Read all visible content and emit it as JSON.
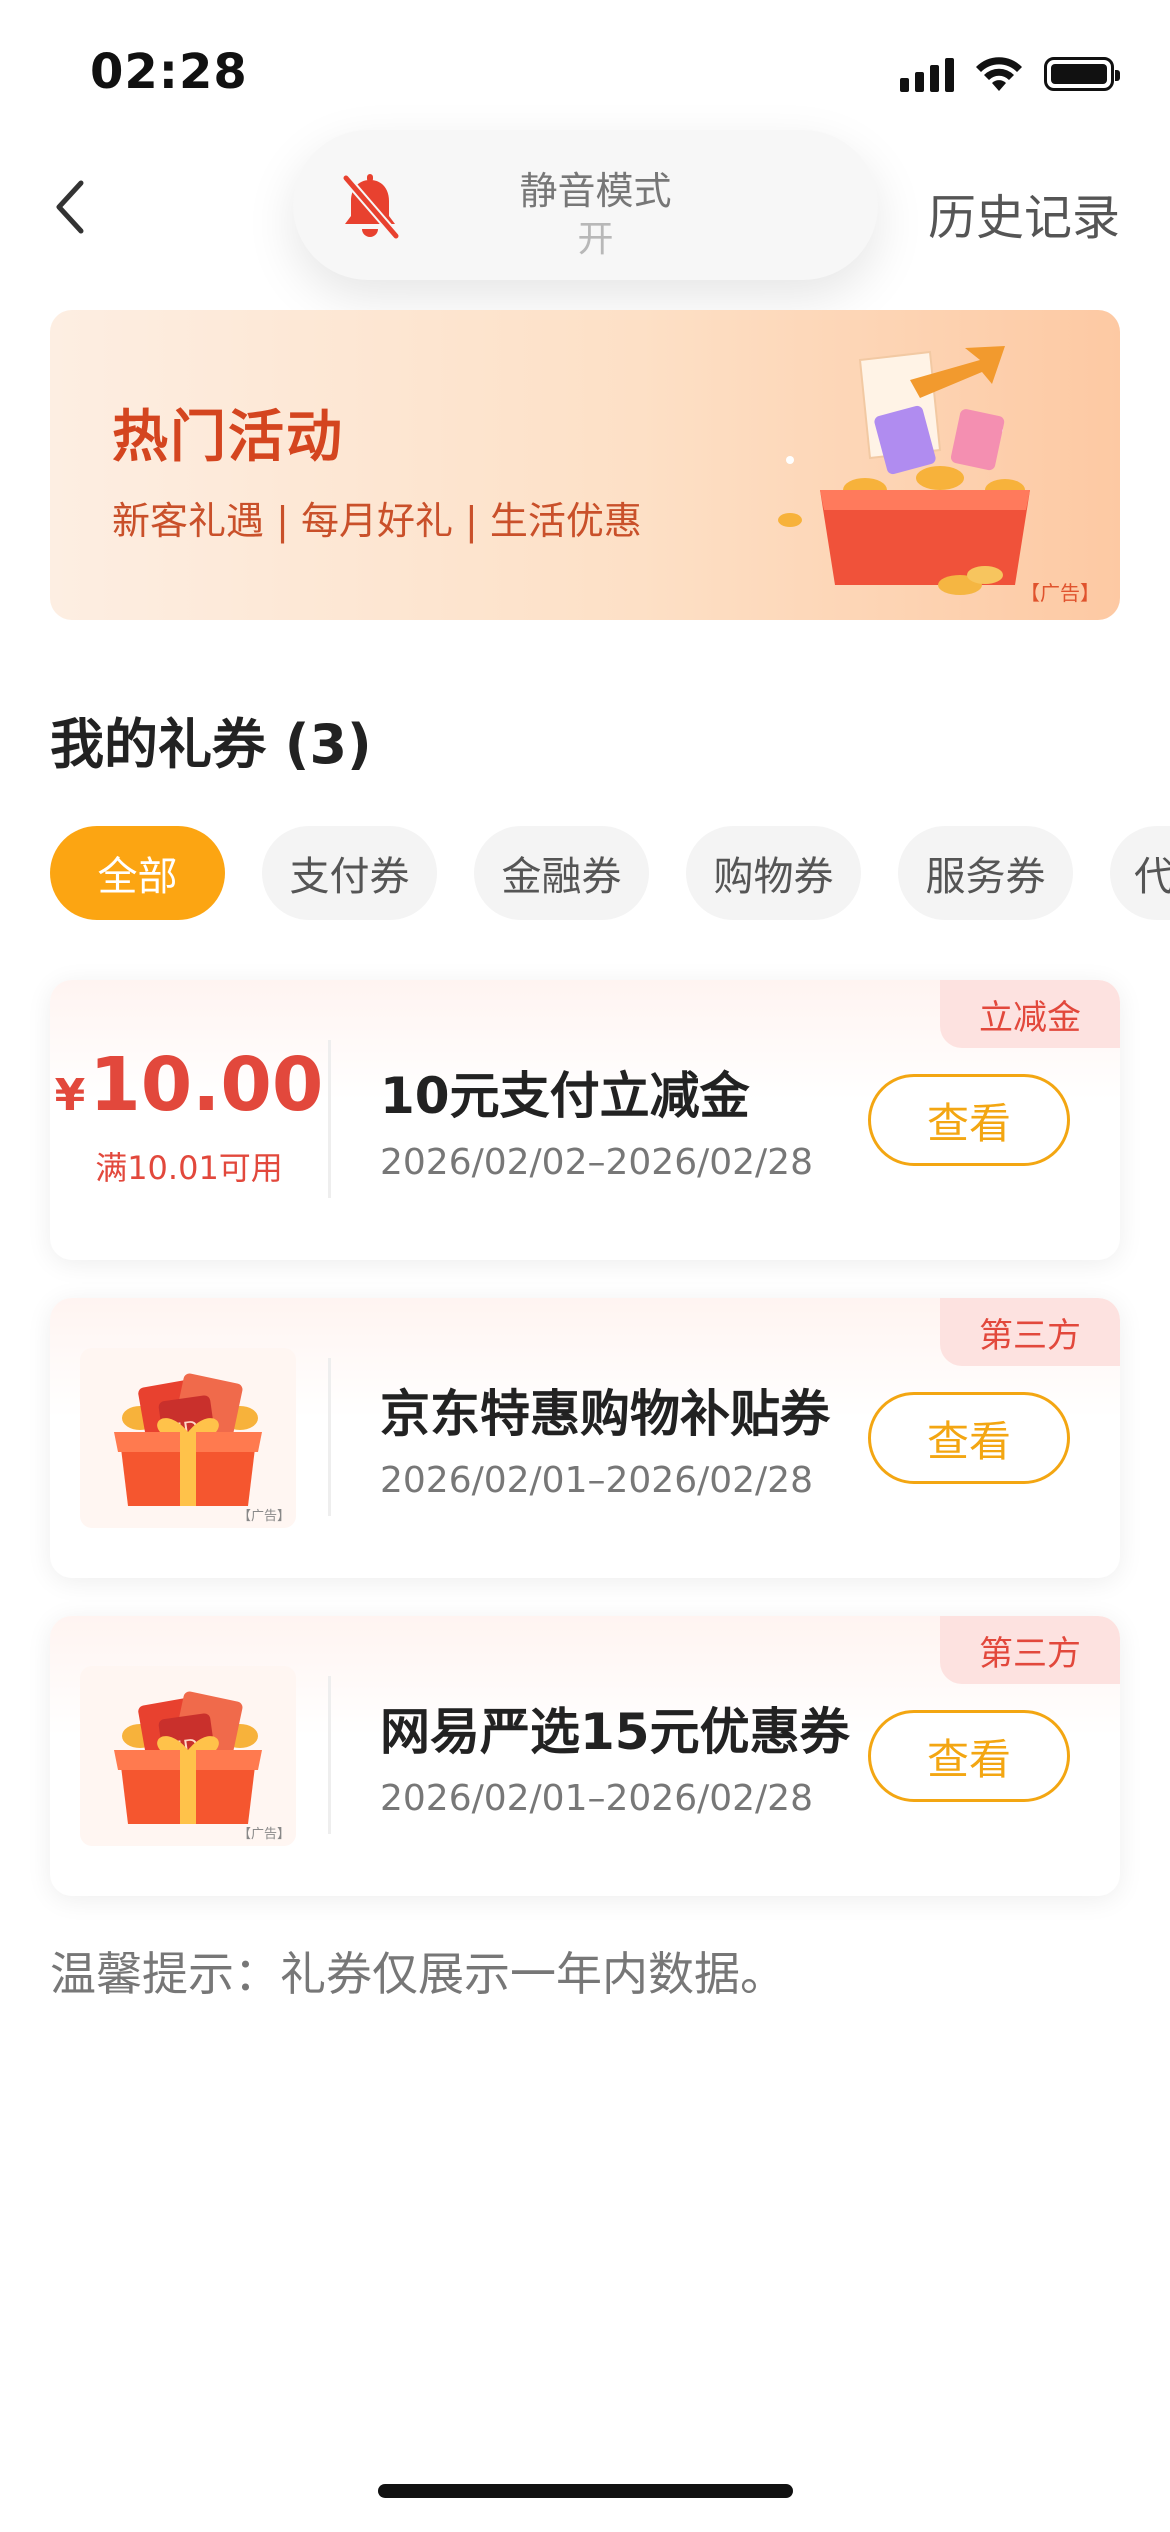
{
  "status_bar": {
    "time": "02:28"
  },
  "nav": {
    "mute_title": "静音模式",
    "mute_state": "开",
    "history": "历史记录"
  },
  "banner": {
    "title": "热门活动",
    "subtitle": "新客礼遇 | 每月好礼 | 生活优惠",
    "ad_label": "【广告】"
  },
  "section": {
    "title": "我的礼券 (3)"
  },
  "filters": [
    "全部",
    "支付券",
    "金融券",
    "购物券",
    "服务券",
    "代"
  ],
  "coupons": [
    {
      "tag": "立减金",
      "currency": "¥",
      "amount": "10.00",
      "condition": "满10.01可用",
      "name": "10元支付立减金",
      "date": "2026/02/02–2026/02/28",
      "button": "查看"
    },
    {
      "tag": "第三方",
      "thumb_ad": "【广告】",
      "name": "京东特惠购物补贴券",
      "date": "2026/02/01–2026/02/28",
      "button": "查看"
    },
    {
      "tag": "第三方",
      "thumb_ad": "【广告】",
      "name": "网易严选15元优惠券",
      "date": "2026/02/01–2026/02/28",
      "button": "查看"
    }
  ],
  "tip": "温馨提示：礼券仅展示一年内数据。",
  "colors": {
    "accent_orange": "#fca512",
    "price_red": "#e2483c",
    "banner_title": "#d4451f",
    "mute_bell": "#e8412f"
  },
  "icons": {
    "back": "chevron-left-icon",
    "mute": "bell-slash-icon",
    "signal": "cellular-signal-icon",
    "wifi": "wifi-icon",
    "battery": "battery-icon"
  }
}
